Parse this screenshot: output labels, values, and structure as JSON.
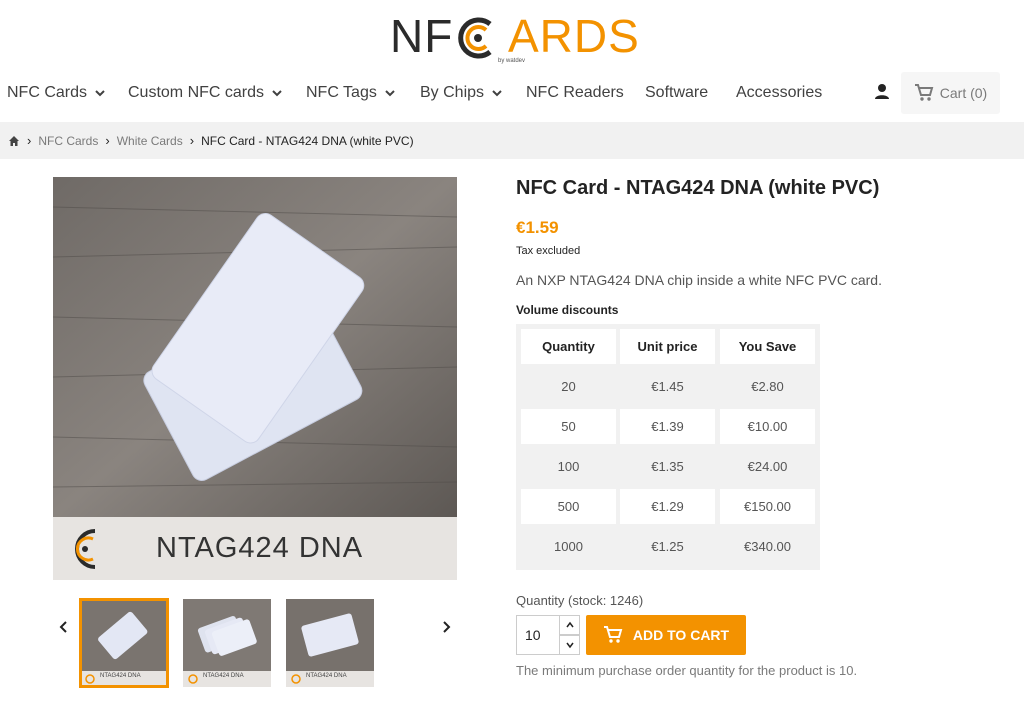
{
  "logo": {
    "left": "NF",
    "right": "ARDS",
    "byline": "by watdev"
  },
  "nav": {
    "items": [
      {
        "label": "NFC Cards",
        "dropdown": true
      },
      {
        "label": "Custom NFC cards",
        "dropdown": true
      },
      {
        "label": "NFC Tags",
        "dropdown": true
      },
      {
        "label": "By Chips",
        "dropdown": true
      },
      {
        "label": "NFC Readers",
        "dropdown": false
      },
      {
        "label": "Software",
        "dropdown": false
      },
      {
        "label": "Accessories",
        "dropdown": false
      }
    ],
    "cart_label": "Cart (0)"
  },
  "breadcrumb": {
    "items": [
      "NFC Cards",
      "White Cards",
      "NFC Card - NTAG424 DNA (white PVC)"
    ]
  },
  "product": {
    "image_caption": "NTAG424 DNA",
    "thumb_caption": "NTAG424 DNA",
    "title": "NFC Card - NTAG424 DNA (white PVC)",
    "price": "€1.59",
    "tax_note": "Tax excluded",
    "description": "An NXP NTAG424 DNA chip inside a white NFC PVC card.",
    "volume_discounts_title": "Volume discounts",
    "volume_headers": [
      "Quantity",
      "Unit price",
      "You Save"
    ],
    "volume_rows": [
      [
        "20",
        "€1.45",
        "€2.80"
      ],
      [
        "50",
        "€1.39",
        "€10.00"
      ],
      [
        "100",
        "€1.35",
        "€24.00"
      ],
      [
        "500",
        "€1.29",
        "€150.00"
      ],
      [
        "1000",
        "€1.25",
        "€340.00"
      ]
    ],
    "quantity_label": "Quantity (stock: 1246)",
    "quantity_value": "10",
    "add_to_cart_label": "ADD TO CART",
    "min_note": "The minimum purchase order quantity for the product is 10."
  },
  "colors": {
    "accent": "#f39200",
    "text": "#232323",
    "muted": "#7a7a7a",
    "breadcrumb_bg": "#f1f1f1"
  },
  "icons": [
    "home-icon",
    "chevron-down-icon",
    "user-icon",
    "cart-icon",
    "chevron-left-icon",
    "chevron-right-icon",
    "chevron-up-icon"
  ]
}
